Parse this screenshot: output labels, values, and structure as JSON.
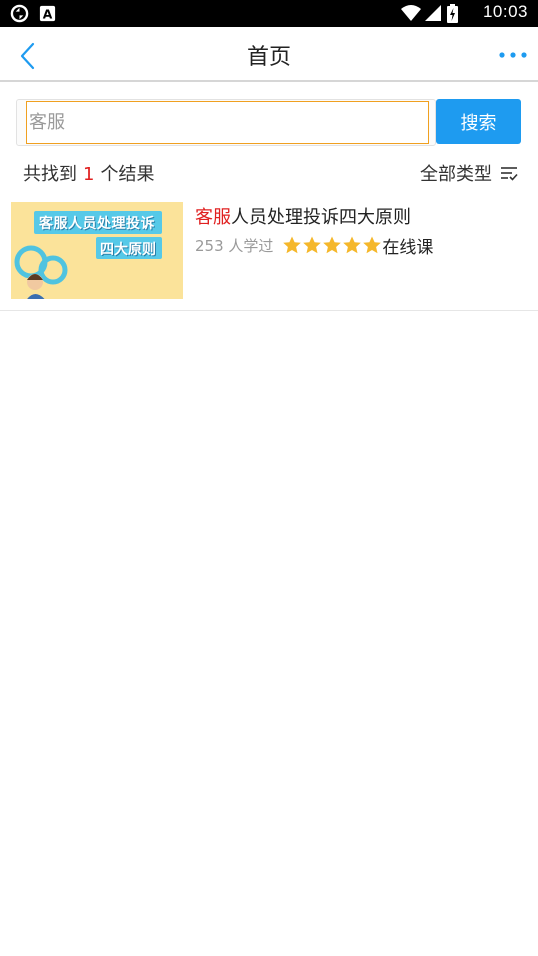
{
  "status_bar": {
    "time": "10:03",
    "icons": [
      "sync-icon",
      "notification-a-icon",
      "wifi-icon",
      "signal-icon",
      "battery-icon"
    ]
  },
  "nav": {
    "title": "首页",
    "back_icon": "back-chevron-icon",
    "more_icon": "more-dots-icon"
  },
  "search": {
    "placeholder": "客服",
    "value": "",
    "button_label": "搜索"
  },
  "summary": {
    "prefix": "共找到",
    "count": "1",
    "suffix": "个结果",
    "filter_label": "全部类型",
    "filter_icon": "filter-list-icon"
  },
  "results": [
    {
      "title_highlight": "客服",
      "title_rest": "人员处理投诉四大原则",
      "learners": "253 人学过",
      "rating": 5,
      "type": "在线课",
      "thumbnail": {
        "line1": "客服人员处理投诉",
        "line2": "四大原则"
      }
    }
  ],
  "colors": {
    "accent": "#1e9bf0",
    "highlight": "#e02020",
    "star": "#f5b72a",
    "input_focus": "#f0a020"
  }
}
